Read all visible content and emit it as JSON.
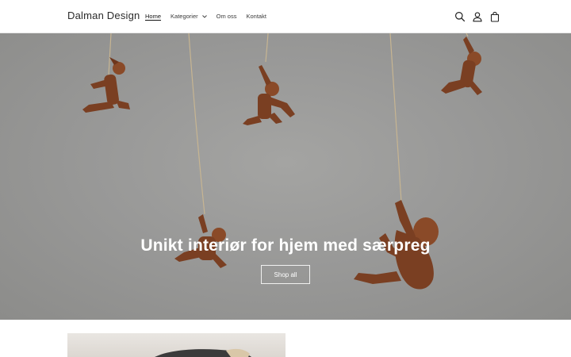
{
  "header": {
    "logo": "Dalman Design",
    "nav": {
      "home": "Home",
      "categories": "Kategorier",
      "about": "Om oss",
      "contact": "Kontakt"
    },
    "icons": [
      "search-icon",
      "account-icon",
      "cart-icon"
    ]
  },
  "hero": {
    "title": "Unikt interiør for hjem med særpreg",
    "button": "Shop all"
  },
  "colors": {
    "hero_background": "#999998",
    "figure": "#7a3f22",
    "rope": "#c9b89a",
    "text_on_hero": "#ffffff"
  }
}
